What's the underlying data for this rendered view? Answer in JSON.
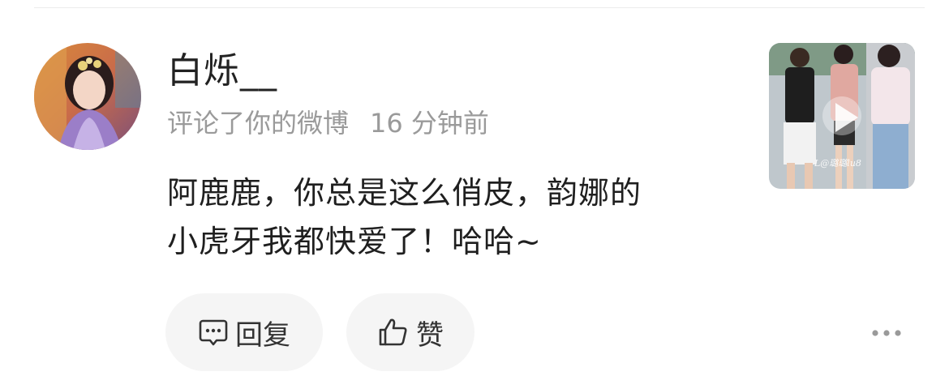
{
  "comment": {
    "username": "白烁__",
    "action_text": "评论了你的微博",
    "time_ago": "16 分钟前",
    "text_lines": [
      "阿鹿鹿，你总是这么俏皮，韵娜的",
      "小虎牙我都快爱了！哈哈~"
    ]
  },
  "thumbnail": {
    "watermark": "L@璐璐lu8"
  },
  "actions": {
    "reply_label": "回复",
    "like_label": "赞"
  },
  "icons": {
    "reply": "comment-bubble-icon",
    "like": "thumbs-up-icon",
    "more": "more-dots-icon",
    "play": "play-icon"
  },
  "colors": {
    "username": "#222222",
    "meta": "#9a9a9a",
    "pill_bg": "#f5f5f5"
  }
}
